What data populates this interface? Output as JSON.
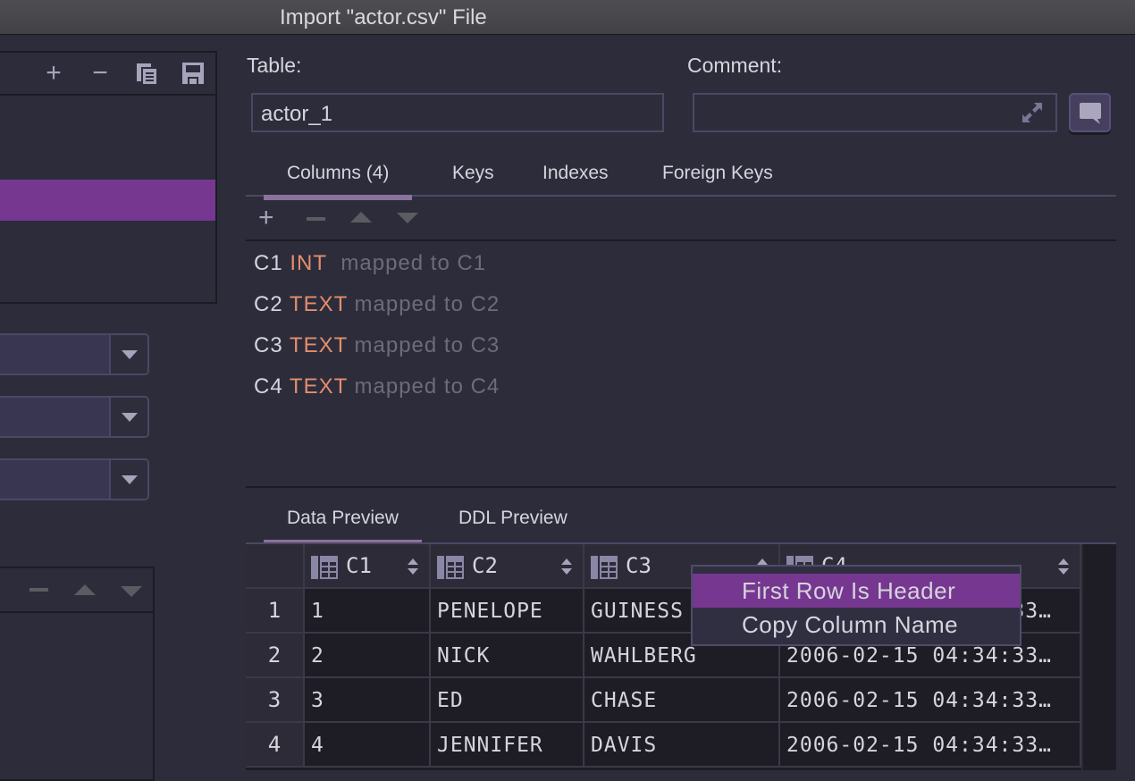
{
  "window": {
    "title": "Import \"actor.csv\" File"
  },
  "left_panel": {
    "toolbar": [
      {
        "name": "add",
        "icon": "plus-icon"
      },
      {
        "name": "remove",
        "icon": "minus-icon"
      },
      {
        "name": "copy",
        "icon": "copy-icon"
      },
      {
        "name": "save",
        "icon": "save-icon"
      }
    ],
    "selected_item_index": 2
  },
  "form": {
    "table_label": "Table:",
    "table_value": "actor_1",
    "comment_label": "Comment:",
    "comment_value": ""
  },
  "tabs": [
    {
      "label": "Columns (4)",
      "active": true
    },
    {
      "label": "Keys",
      "active": false
    },
    {
      "label": "Indexes",
      "active": false
    },
    {
      "label": "Foreign Keys",
      "active": false
    }
  ],
  "columns": [
    {
      "name": "C1",
      "type": "INT",
      "mapping": "mapped to C1"
    },
    {
      "name": "C2",
      "type": "TEXT",
      "mapping": "mapped to C2"
    },
    {
      "name": "C3",
      "type": "TEXT",
      "mapping": "mapped to C3"
    },
    {
      "name": "C4",
      "type": "TEXT",
      "mapping": "mapped to C4"
    }
  ],
  "preview_tabs": [
    {
      "label": "Data Preview",
      "active": true
    },
    {
      "label": "DDL Preview",
      "active": false
    }
  ],
  "grid": {
    "headers": [
      "C1",
      "C2",
      "C3",
      "C4"
    ],
    "rows": [
      {
        "num": "1",
        "cells": [
          "1",
          "PENELOPE",
          "GUINESS",
          "2006-02-15 04:34:33…"
        ]
      },
      {
        "num": "2",
        "cells": [
          "2",
          "NICK",
          "WAHLBERG",
          "2006-02-15 04:34:33…"
        ]
      },
      {
        "num": "3",
        "cells": [
          "3",
          "ED",
          "CHASE",
          "2006-02-15 04:34:33…"
        ]
      },
      {
        "num": "4",
        "cells": [
          "4",
          "JENNIFER",
          "DAVIS",
          "2006-02-15 04:34:33…"
        ]
      }
    ]
  },
  "context_menu": {
    "items": [
      {
        "label": "First Row Is Header",
        "highlighted": true
      },
      {
        "label": "Copy Column Name",
        "highlighted": false
      }
    ]
  },
  "colors": {
    "accent": "#763790",
    "type_color": "#e38e6c",
    "background": "#2d2c3b"
  }
}
